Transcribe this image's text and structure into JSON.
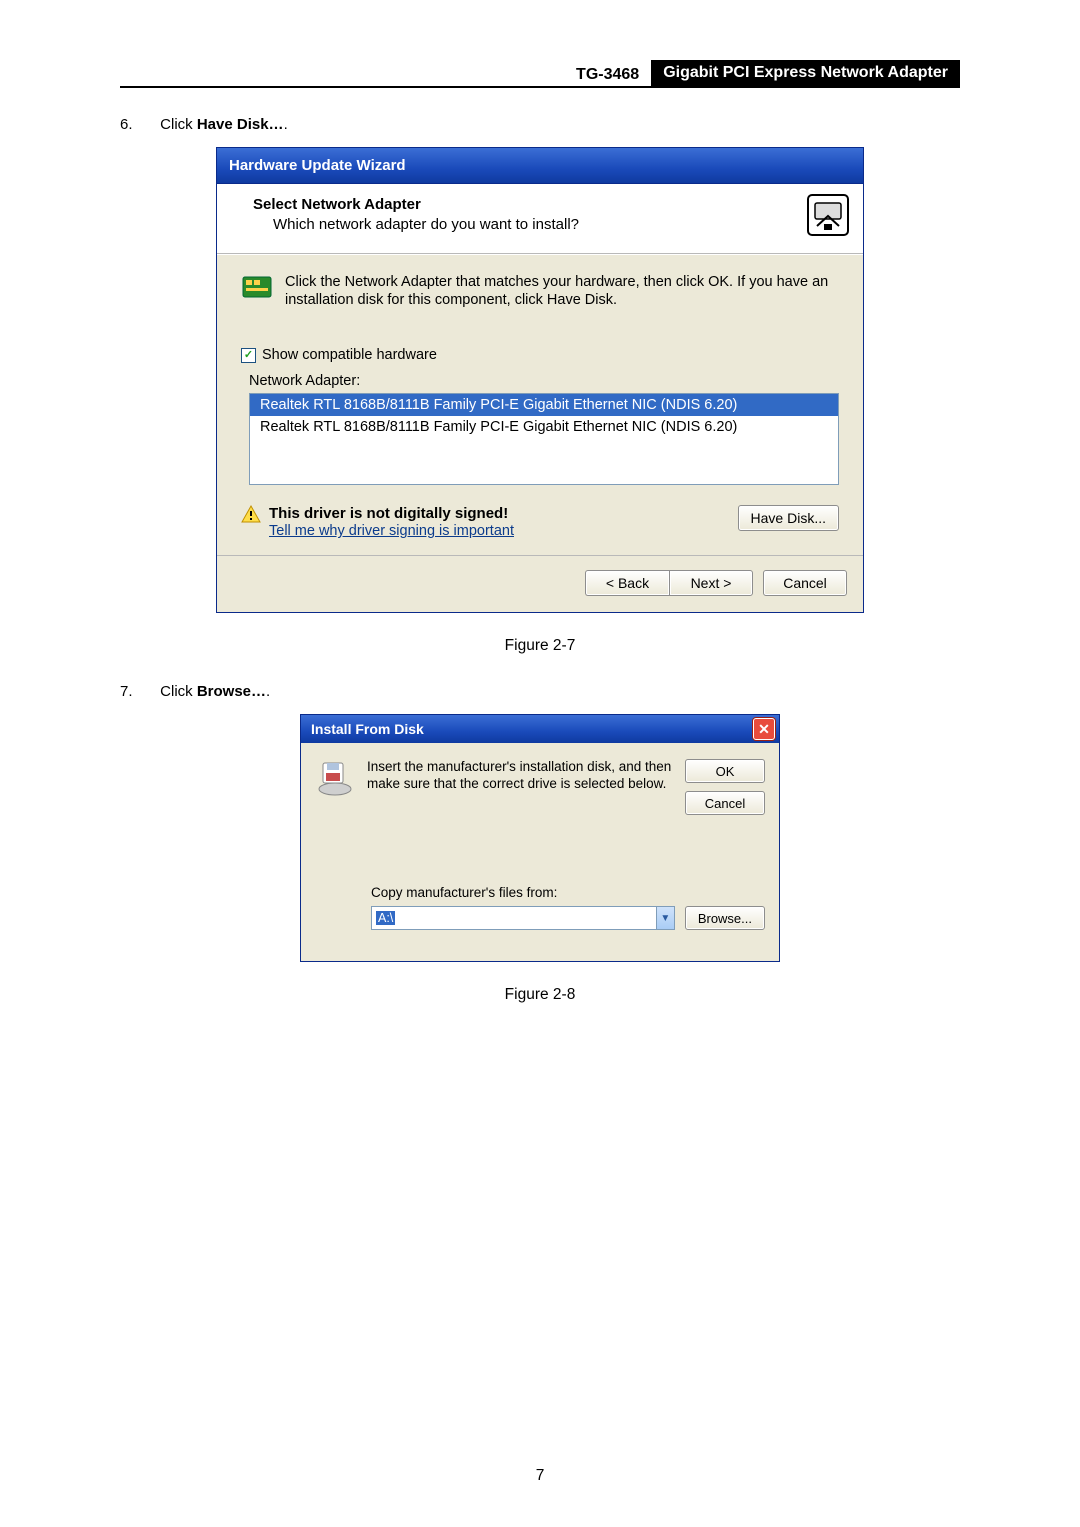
{
  "header": {
    "model": "TG-3468",
    "title": "Gigabit PCI Express Network Adapter"
  },
  "step6": {
    "num": "6.",
    "prefix": "Click ",
    "bold": "Have Disk…",
    "suffix": "."
  },
  "wiz1": {
    "titlebar": "Hardware Update Wizard",
    "head_title": "Select Network Adapter",
    "head_sub": "Which network adapter do you want to install?",
    "body_text": "Click the Network Adapter that matches your hardware, then click OK. If you have an installation disk for this component, click Have Disk.",
    "chk_label": "Show compatible hardware",
    "list_label": "Network Adapter:",
    "list_items": [
      "Realtek RTL 8168B/8111B Family PCI-E Gigabit Ethernet NIC (NDIS 6.20)",
      "Realtek RTL 8168B/8111B Family PCI-E Gigabit Ethernet NIC (NDIS 6.20)"
    ],
    "warn_title": "This driver is not digitally signed!",
    "warn_link": "Tell me why driver signing is important",
    "have_disk_btn": "Have Disk...",
    "back_btn": "< Back",
    "next_btn": "Next >",
    "cancel_btn": "Cancel"
  },
  "caption1": "Figure 2-7",
  "step7": {
    "num": "7.",
    "prefix": "Click ",
    "bold": "Browse…",
    "suffix": "."
  },
  "dlg2": {
    "titlebar": "Install From Disk",
    "body_text": "Insert the manufacturer's installation disk, and then make sure that the correct drive is selected below.",
    "ok_btn": "OK",
    "cancel_btn": "Cancel",
    "copy_label": "Copy manufacturer's files from:",
    "combo_value": "A:\\",
    "browse_btn": "Browse..."
  },
  "caption2": "Figure 2-8",
  "pagenum": "7"
}
